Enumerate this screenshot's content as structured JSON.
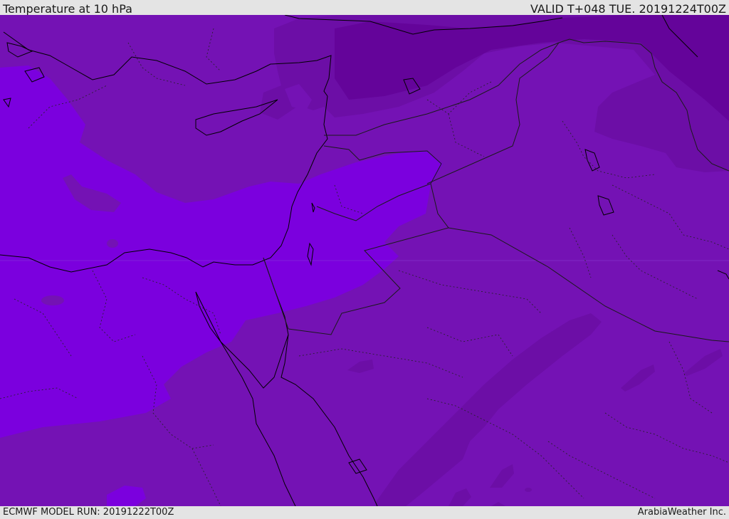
{
  "header": {
    "title": "Temperature at 10 hPa",
    "valid": "VALID T+048 TUE. 20191224T00Z"
  },
  "footer": {
    "model_run": "ECMWF MODEL RUN: 20191222T00Z",
    "credit": "ArabiaWeather Inc."
  },
  "colors": {
    "warmest_band": "#7b00de",
    "mid_band": "#7412b4",
    "cool_band": "#6c0ea6",
    "coldest_band": "#64049a",
    "coastline": "#000000",
    "border": "#1a1a1a"
  }
}
